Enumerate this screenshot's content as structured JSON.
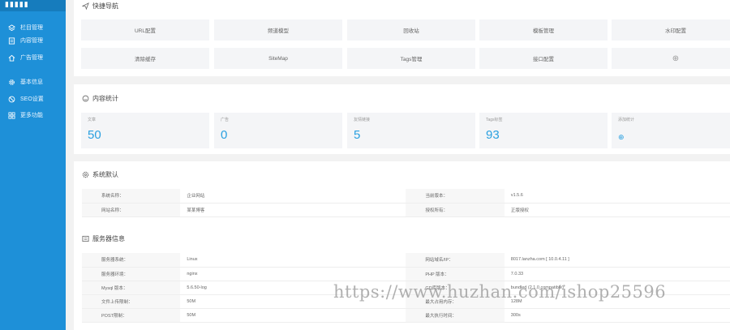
{
  "sidebar": {
    "logo": "▮▮▮▮▮",
    "items": [
      {
        "label": "栏目管理",
        "icon": "layers-icon"
      },
      {
        "label": "内容管理",
        "icon": "document-icon"
      },
      {
        "label": "广告管理",
        "icon": "home-icon"
      },
      {
        "label": "基本信息",
        "icon": "gear-icon"
      },
      {
        "label": "SEO设置",
        "icon": "circle-slash-icon"
      },
      {
        "label": "更多功能",
        "icon": "grid-icon"
      }
    ]
  },
  "quick_nav": {
    "title": "快捷导航",
    "buttons": [
      "URL配置",
      "频道模型",
      "回收站",
      "模板管理",
      "水印配置",
      "清除缓存",
      "SiteMap",
      "Tags管理",
      "接口配置",
      "⊕"
    ]
  },
  "stats": {
    "title": "内容统计",
    "items": [
      {
        "label": "文章",
        "value": "50"
      },
      {
        "label": "广告",
        "value": "0"
      },
      {
        "label": "友情链接",
        "value": "5"
      },
      {
        "label": "Tags标签",
        "value": "93"
      },
      {
        "label": "添加统计",
        "value": "⊕"
      }
    ]
  },
  "system": {
    "title": "系统默认",
    "rows": [
      [
        "系统名称：",
        "企业网站",
        "当前版本：",
        "v1.5.6"
      ],
      [
        "网站名称：",
        "某某博客",
        "授权所有：",
        "正版授权"
      ]
    ]
  },
  "server": {
    "title": "服务器信息",
    "rows": [
      [
        "服务器系统：",
        "Linux",
        "网站域名/IP：",
        "8017.lanzha.com [ 10.0.4.11 ]"
      ],
      [
        "服务器环境：",
        "nginx",
        "PHP 版本：",
        "7.0.33"
      ],
      [
        "Mysql 版本：",
        "5.6.50-log",
        "GD库版本：",
        "bundled (2.1.0 compatible)"
      ],
      [
        "文件上传限制：",
        "50M",
        "最大占用内存：",
        "128M"
      ],
      [
        "POST限制：",
        "50M",
        "最大执行时间：",
        "300s"
      ]
    ]
  },
  "watermark": "https://www.huzhan.com/ishop25596",
  "colors": {
    "sidebar": "#1e90d8",
    "accent": "#2aa0e0"
  }
}
